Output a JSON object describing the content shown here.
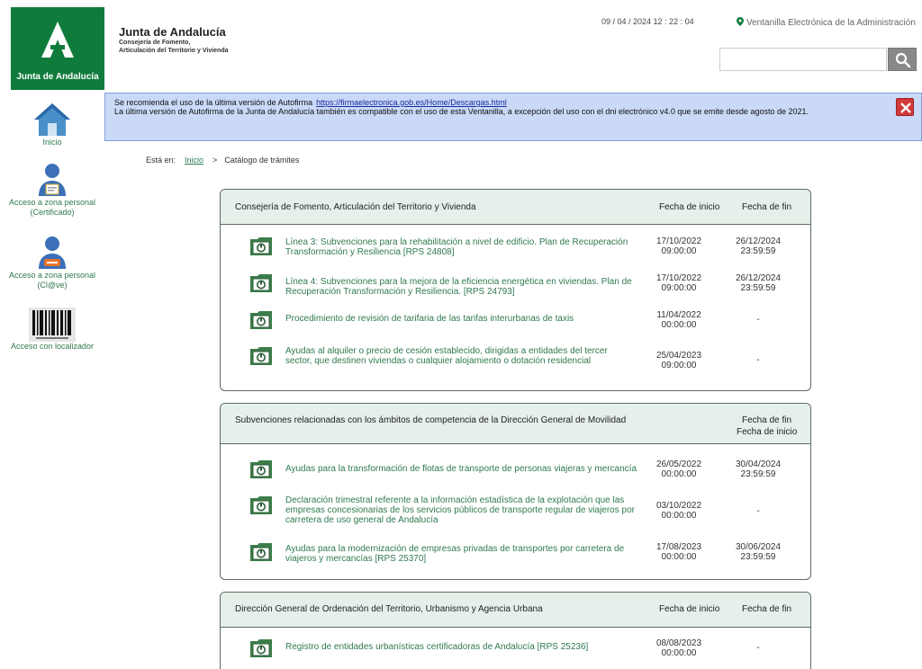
{
  "header": {
    "logo_text": "Junta de Andalucía",
    "org_title": "Junta de Andalucía",
    "org_sub1": "Consejería de Fomento,",
    "org_sub2": "Articulación del Territorio y Vivienda",
    "datetime": "09 / 04 / 2024   12 : 22 : 04",
    "ventanilla": "Ventanilla Electrónica de la Administración",
    "search_placeholder": ""
  },
  "banner": {
    "line1": "Se recomienda el uso de la última versión de Autofirma",
    "link": "https://firmaelectronica.gob.es/Home/Descargas.html",
    "line2": "La última versión de Autofirma de la Junta de Andalucía también es compatible con el uso de esta Ventanilla, a excepción del uso con el dni electrónico v4.0 que se emite desde agosto de 2021."
  },
  "sidebar": {
    "items": [
      {
        "label": "Inicio"
      },
      {
        "label": "Acceso a zona personal (Certificado)"
      },
      {
        "label": "Acceso a zona personal (Cl@ve)"
      },
      {
        "label": "Acceso con localizador"
      }
    ]
  },
  "breadcrumb": {
    "prefix": "Está en:",
    "home": "Inicio",
    "sep": ">",
    "current": "Catálogo de trámites"
  },
  "panels": [
    {
      "title": "Consejería de Fomento, Articulación del Territorio y Vivienda",
      "col_start": "Fecha de inicio",
      "col_end": "Fecha de fin",
      "rows": [
        {
          "title": "Línea 3: Subvenciones para la rehabilitación a nivel de edificio. Plan de Recuperación Transformación y Resiliencia [RPS 24808]",
          "start": "17/10/2022 09:00:00",
          "end": "26/12/2024 23:59:59"
        },
        {
          "title": "Línea 4: Subvenciones para la mejora de la eficiencia energética en viviendas. Plan de Recuperación Transformación y Resiliencia. [RPS 24793]",
          "start": "17/10/2022 09:00:00",
          "end": "26/12/2024 23:59:59"
        },
        {
          "title": "Procedimiento de revisión de tarifaria de las tarifas interurbanas de taxis",
          "start": "11/04/2022 00:00:00",
          "end": "-"
        },
        {
          "title": "Ayudas al alquiler o precio de cesión establecido, dirigidas a entidades del tercer sector, que destinen viviendas o cualquier alojamiento o dotación residencial",
          "start": "25/04/2023 09:00:00",
          "end": "-"
        }
      ]
    },
    {
      "title": "Subvenciones relacionadas con los ámbitos de competencia de la Dirección General de Movilidad",
      "col_start": "Fecha de fin",
      "col_end": "Fecha de inicio",
      "rows": [
        {
          "title": "Ayudas para la transformación de flotas de transporte de personas viajeras y mercancía",
          "start": "26/05/2022 00:00:00",
          "end": "30/04/2024 23:59:59"
        },
        {
          "title": "Declaración trimestral referente a la información estadística de la explotación que las empresas concesionarias de los servicios públicos de transporte regular de viajeros por carretera de uso general de Andalucía",
          "start": "03/10/2022 00:00:00",
          "end": "-"
        },
        {
          "title": "Ayudas para la modernización de empresas privadas de transportes por carretera de viajeros y mercancías [RPS 25370]",
          "start": "17/08/2023 00:00:00",
          "end": "30/06/2024 23:59:59"
        }
      ]
    },
    {
      "title": "Dirección General de Ordenación del Territorio, Urbanismo y Agencia Urbana",
      "col_start": "Fecha de inicio",
      "col_end": "Fecha de fin",
      "rows": [
        {
          "title": "Registro de entidades urbanísticas certificadoras de Andalucía [RPS 25236]",
          "start": "08/08/2023 00:00:00",
          "end": "-"
        }
      ]
    }
  ]
}
